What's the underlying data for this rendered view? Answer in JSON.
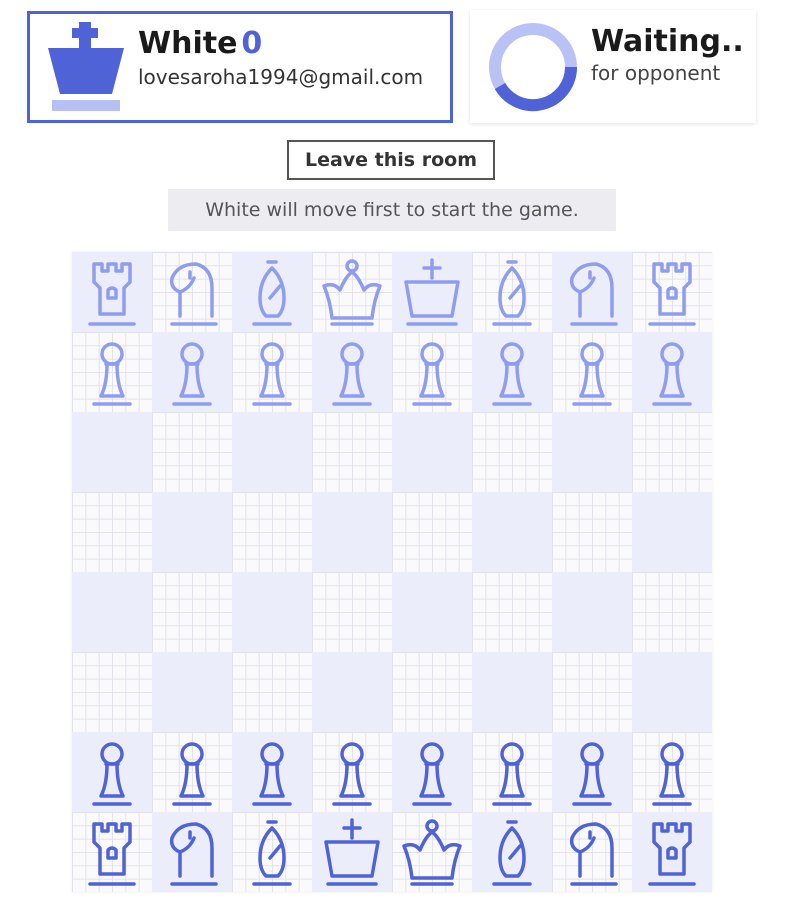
{
  "player": {
    "name": "White",
    "score": "0",
    "email": "lovesaroha1994@gmail.com"
  },
  "opponent": {
    "title": "Waiting..",
    "subtitle": "for opponent"
  },
  "controls": {
    "leave_label": "Leave this room"
  },
  "status": {
    "message": "White will move first to start the game."
  },
  "colors": {
    "accent": "#4f63d7",
    "black_piece": "#8e9df0",
    "light_square": "#ecedfb",
    "grid_square": "#fafafd"
  },
  "board": {
    "ranks": [
      [
        "black-rook",
        "black-knight",
        "black-bishop",
        "black-queen",
        "black-king",
        "black-bishop",
        "black-knight",
        "black-rook"
      ],
      [
        "black-pawn",
        "black-pawn",
        "black-pawn",
        "black-pawn",
        "black-pawn",
        "black-pawn",
        "black-pawn",
        "black-pawn"
      ],
      [
        "",
        "",
        "",
        "",
        "",
        "",
        "",
        ""
      ],
      [
        "",
        "",
        "",
        "",
        "",
        "",
        "",
        ""
      ],
      [
        "",
        "",
        "",
        "",
        "",
        "",
        "",
        ""
      ],
      [
        "",
        "",
        "",
        "",
        "",
        "",
        "",
        ""
      ],
      [
        "white-pawn",
        "white-pawn",
        "white-pawn",
        "white-pawn",
        "white-pawn",
        "white-pawn",
        "white-pawn",
        "white-pawn"
      ],
      [
        "white-rook",
        "white-knight",
        "white-bishop",
        "white-king",
        "white-queen",
        "white-bishop",
        "white-knight",
        "white-rook"
      ]
    ]
  }
}
